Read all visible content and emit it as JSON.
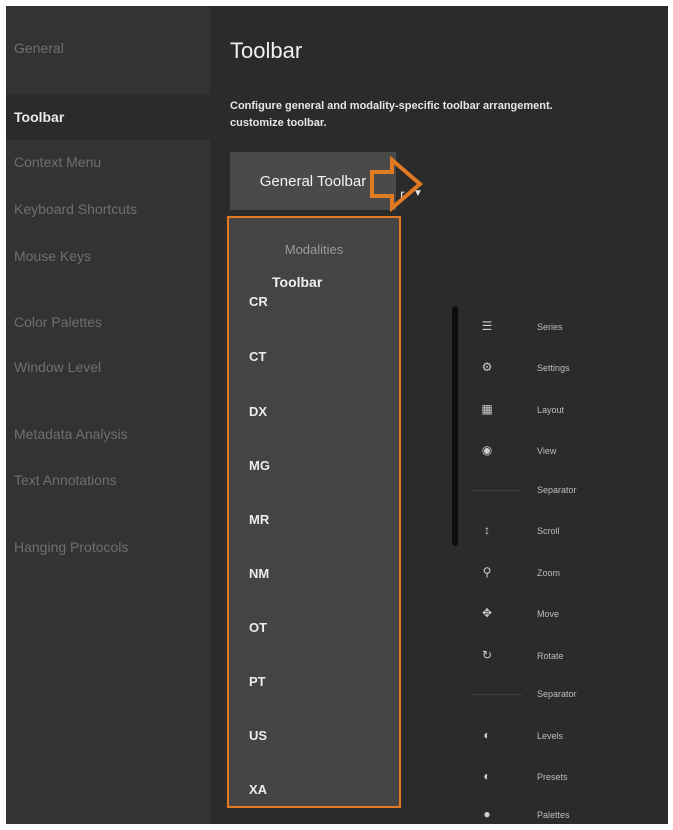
{
  "sidebar": {
    "items": [
      {
        "label": "General"
      },
      {
        "label": "Toolbar"
      },
      {
        "label": "Context Menu"
      },
      {
        "label": "Keyboard Shortcuts"
      },
      {
        "label": "Mouse Keys"
      },
      {
        "label": "Color Palettes"
      },
      {
        "label": "Window Level"
      },
      {
        "label": "Metadata Analysis"
      },
      {
        "label": "Text Annotations"
      },
      {
        "label": "Hanging Protocols"
      }
    ],
    "active": "Toolbar"
  },
  "main": {
    "title": "Toolbar",
    "description_line1": "Configure general and modality-specific toolbar arrangement.",
    "description_line2": "customize toolbar.",
    "dropdown": {
      "selected": "General Toolbar",
      "obscured_text": "r",
      "header": "Modalities",
      "options": [
        "CR",
        "CT",
        "DX",
        "MG",
        "MR",
        "NM",
        "OT",
        "PT",
        "US",
        "XA"
      ]
    }
  },
  "toolbar_panel": {
    "title": "Toolbar",
    "items": [
      {
        "icon": "series-icon",
        "label": "Series"
      },
      {
        "icon": "settings-icon",
        "label": "Settings"
      },
      {
        "icon": "layout-icon",
        "label": "Layout"
      },
      {
        "icon": "view-icon",
        "label": "View"
      },
      {
        "icon": "separator-line",
        "label": "Separator"
      },
      {
        "icon": "scroll-icon",
        "label": "Scroll"
      },
      {
        "icon": "zoom-icon",
        "label": "Zoom"
      },
      {
        "icon": "move-icon",
        "label": "Move"
      },
      {
        "icon": "rotate-icon",
        "label": "Rotate"
      },
      {
        "icon": "separator-line",
        "label": "Separator"
      },
      {
        "icon": "levels-icon",
        "label": "Levels"
      },
      {
        "icon": "presets-icon",
        "label": "Presets"
      },
      {
        "icon": "palettes-icon",
        "label": "Palettes"
      }
    ]
  },
  "colors": {
    "accent_highlight": "#e07b22",
    "background": "#2b2b2b",
    "sidebar": "#333333"
  }
}
